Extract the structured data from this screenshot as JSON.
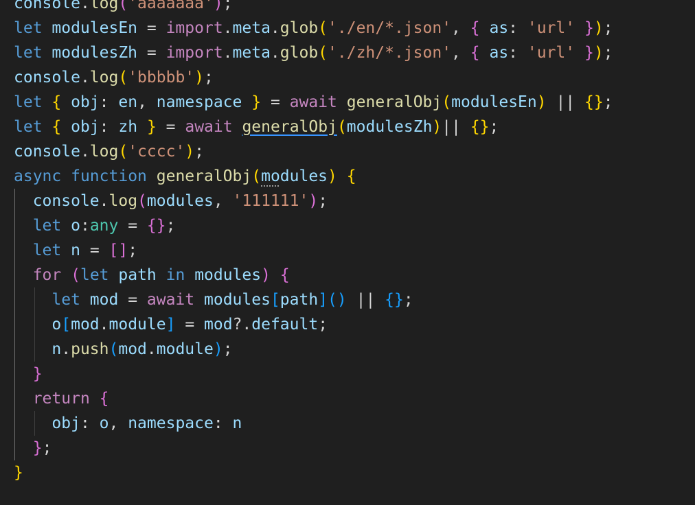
{
  "editor": {
    "theme_colors": {
      "background": "#1f1f1f",
      "keyword_blue": "#569cd6",
      "keyword_control": "#c586c0",
      "variable": "#9cdcfe",
      "function": "#dcdcaa",
      "string": "#ce9178",
      "number": "#b5cea8",
      "type": "#4ec9b0",
      "punctuation": "#d4d4d4",
      "bracket1": "#ffd700",
      "bracket2": "#da70d6",
      "bracket3": "#179fff"
    },
    "lines": [
      {
        "indent": 0,
        "tokens": [
          {
            "t": "console",
            "c": "variable"
          },
          {
            "t": ".",
            "c": "punctuation"
          },
          {
            "t": "log",
            "c": "function"
          },
          {
            "t": "(",
            "c": "bracket2"
          },
          {
            "t": "'aaaaaaa'",
            "c": "string"
          },
          {
            "t": ")",
            "c": "bracket2"
          },
          {
            "t": ";",
            "c": "punctuation"
          }
        ]
      },
      {
        "indent": 0,
        "tokens": [
          {
            "t": "let",
            "c": "keyword_blue"
          },
          {
            "t": " ",
            "c": "punctuation"
          },
          {
            "t": "modulesEn",
            "c": "variable"
          },
          {
            "t": " = ",
            "c": "punctuation"
          },
          {
            "t": "import",
            "c": "keyword_control"
          },
          {
            "t": ".",
            "c": "punctuation"
          },
          {
            "t": "meta",
            "c": "variable"
          },
          {
            "t": ".",
            "c": "punctuation"
          },
          {
            "t": "glob",
            "c": "function"
          },
          {
            "t": "(",
            "c": "bracket1"
          },
          {
            "t": "'./en/*.json'",
            "c": "string"
          },
          {
            "t": ", ",
            "c": "punctuation"
          },
          {
            "t": "{",
            "c": "bracket2"
          },
          {
            "t": " ",
            "c": "punctuation"
          },
          {
            "t": "as",
            "c": "variable"
          },
          {
            "t": ": ",
            "c": "punctuation"
          },
          {
            "t": "'url'",
            "c": "string"
          },
          {
            "t": " ",
            "c": "punctuation"
          },
          {
            "t": "}",
            "c": "bracket2"
          },
          {
            "t": ")",
            "c": "bracket1"
          },
          {
            "t": ";",
            "c": "punctuation"
          }
        ]
      },
      {
        "indent": 0,
        "tokens": [
          {
            "t": "let",
            "c": "keyword_blue"
          },
          {
            "t": " ",
            "c": "punctuation"
          },
          {
            "t": "modulesZh",
            "c": "variable"
          },
          {
            "t": " = ",
            "c": "punctuation"
          },
          {
            "t": "import",
            "c": "keyword_control"
          },
          {
            "t": ".",
            "c": "punctuation"
          },
          {
            "t": "meta",
            "c": "variable"
          },
          {
            "t": ".",
            "c": "punctuation"
          },
          {
            "t": "glob",
            "c": "function"
          },
          {
            "t": "(",
            "c": "bracket1"
          },
          {
            "t": "'./zh/*.json'",
            "c": "string"
          },
          {
            "t": ", ",
            "c": "punctuation"
          },
          {
            "t": "{",
            "c": "bracket2"
          },
          {
            "t": " ",
            "c": "punctuation"
          },
          {
            "t": "as",
            "c": "variable"
          },
          {
            "t": ": ",
            "c": "punctuation"
          },
          {
            "t": "'url'",
            "c": "string"
          },
          {
            "t": " ",
            "c": "punctuation"
          },
          {
            "t": "}",
            "c": "bracket2"
          },
          {
            "t": ")",
            "c": "bracket1"
          },
          {
            "t": ";",
            "c": "punctuation"
          }
        ]
      },
      {
        "indent": 0,
        "tokens": [
          {
            "t": "console",
            "c": "variable"
          },
          {
            "t": ".",
            "c": "punctuation"
          },
          {
            "t": "log",
            "c": "function"
          },
          {
            "t": "(",
            "c": "bracket1"
          },
          {
            "t": "'bbbbb'",
            "c": "string"
          },
          {
            "t": ")",
            "c": "bracket1"
          },
          {
            "t": ";",
            "c": "punctuation"
          }
        ]
      },
      {
        "indent": 0,
        "tokens": [
          {
            "t": "let",
            "c": "keyword_blue"
          },
          {
            "t": " ",
            "c": "punctuation"
          },
          {
            "t": "{",
            "c": "bracket1"
          },
          {
            "t": " ",
            "c": "punctuation"
          },
          {
            "t": "obj",
            "c": "variable"
          },
          {
            "t": ": ",
            "c": "punctuation"
          },
          {
            "t": "en",
            "c": "variable"
          },
          {
            "t": ", ",
            "c": "punctuation"
          },
          {
            "t": "namespace",
            "c": "variable"
          },
          {
            "t": " ",
            "c": "punctuation"
          },
          {
            "t": "}",
            "c": "bracket1"
          },
          {
            "t": " = ",
            "c": "punctuation"
          },
          {
            "t": "await",
            "c": "keyword_control"
          },
          {
            "t": " ",
            "c": "punctuation"
          },
          {
            "t": "generalObj",
            "c": "function"
          },
          {
            "t": "(",
            "c": "bracket1"
          },
          {
            "t": "modulesEn",
            "c": "variable"
          },
          {
            "t": ")",
            "c": "bracket1"
          },
          {
            "t": " || ",
            "c": "punctuation"
          },
          {
            "t": "{}",
            "c": "bracket1"
          },
          {
            "t": ";",
            "c": "punctuation"
          }
        ]
      },
      {
        "indent": 0,
        "tokens": [
          {
            "t": "let",
            "c": "keyword_blue"
          },
          {
            "t": " ",
            "c": "punctuation"
          },
          {
            "t": "{",
            "c": "bracket1"
          },
          {
            "t": " ",
            "c": "punctuation"
          },
          {
            "t": "obj",
            "c": "variable"
          },
          {
            "t": ": ",
            "c": "punctuation"
          },
          {
            "t": "zh",
            "c": "variable"
          },
          {
            "t": " ",
            "c": "punctuation"
          },
          {
            "t": "}",
            "c": "bracket1"
          },
          {
            "t": " = ",
            "c": "punctuation"
          },
          {
            "t": "await",
            "c": "keyword_control"
          },
          {
            "t": " ",
            "c": "punctuation"
          },
          {
            "t": "generalObj",
            "c": "function",
            "u": true
          },
          {
            "t": "(",
            "c": "bracket1"
          },
          {
            "t": "modulesZh",
            "c": "variable"
          },
          {
            "t": ")",
            "c": "bracket1"
          },
          {
            "t": "|| ",
            "c": "punctuation"
          },
          {
            "t": "{}",
            "c": "bracket1"
          },
          {
            "t": ";",
            "c": "punctuation"
          }
        ]
      },
      {
        "indent": 0,
        "tokens": [
          {
            "t": "console",
            "c": "variable"
          },
          {
            "t": ".",
            "c": "punctuation"
          },
          {
            "t": "log",
            "c": "function"
          },
          {
            "t": "(",
            "c": "bracket1"
          },
          {
            "t": "'cccc'",
            "c": "string"
          },
          {
            "t": ")",
            "c": "bracket1"
          },
          {
            "t": ";",
            "c": "punctuation"
          }
        ]
      },
      {
        "indent": 0,
        "tokens": [
          {
            "t": "async",
            "c": "keyword_blue"
          },
          {
            "t": " ",
            "c": "punctuation"
          },
          {
            "t": "function",
            "c": "keyword_blue"
          },
          {
            "t": " ",
            "c": "punctuation"
          },
          {
            "t": "generalObj",
            "c": "function"
          },
          {
            "t": "(",
            "c": "bracket1"
          },
          {
            "t": "mo",
            "c": "variable",
            "d": true
          },
          {
            "t": "dules",
            "c": "variable"
          },
          {
            "t": ")",
            "c": "bracket1"
          },
          {
            "t": " ",
            "c": "punctuation"
          },
          {
            "t": "{",
            "c": "bracket1"
          }
        ]
      },
      {
        "indent": 1,
        "tokens": [
          {
            "t": "console",
            "c": "variable"
          },
          {
            "t": ".",
            "c": "punctuation"
          },
          {
            "t": "log",
            "c": "function"
          },
          {
            "t": "(",
            "c": "bracket2"
          },
          {
            "t": "modules",
            "c": "variable"
          },
          {
            "t": ", ",
            "c": "punctuation"
          },
          {
            "t": "'111111'",
            "c": "string"
          },
          {
            "t": ")",
            "c": "bracket2"
          },
          {
            "t": ";",
            "c": "punctuation"
          }
        ]
      },
      {
        "indent": 1,
        "tokens": [
          {
            "t": "let",
            "c": "keyword_blue"
          },
          {
            "t": " ",
            "c": "punctuation"
          },
          {
            "t": "o",
            "c": "variable"
          },
          {
            "t": ":",
            "c": "punctuation"
          },
          {
            "t": "any",
            "c": "type"
          },
          {
            "t": " = ",
            "c": "punctuation"
          },
          {
            "t": "{}",
            "c": "bracket2"
          },
          {
            "t": ";",
            "c": "punctuation"
          }
        ]
      },
      {
        "indent": 1,
        "tokens": [
          {
            "t": "let",
            "c": "keyword_blue"
          },
          {
            "t": " ",
            "c": "punctuation"
          },
          {
            "t": "n",
            "c": "variable"
          },
          {
            "t": " = ",
            "c": "punctuation"
          },
          {
            "t": "[]",
            "c": "bracket2"
          },
          {
            "t": ";",
            "c": "punctuation"
          }
        ]
      },
      {
        "indent": 1,
        "tokens": [
          {
            "t": "for",
            "c": "keyword_control"
          },
          {
            "t": " ",
            "c": "punctuation"
          },
          {
            "t": "(",
            "c": "bracket2"
          },
          {
            "t": "let",
            "c": "keyword_blue"
          },
          {
            "t": " ",
            "c": "punctuation"
          },
          {
            "t": "path",
            "c": "variable"
          },
          {
            "t": " ",
            "c": "punctuation"
          },
          {
            "t": "in",
            "c": "keyword_blue"
          },
          {
            "t": " ",
            "c": "punctuation"
          },
          {
            "t": "modules",
            "c": "variable"
          },
          {
            "t": ")",
            "c": "bracket2"
          },
          {
            "t": " ",
            "c": "punctuation"
          },
          {
            "t": "{",
            "c": "bracket2"
          }
        ]
      },
      {
        "indent": 2,
        "tokens": [
          {
            "t": "let",
            "c": "keyword_blue"
          },
          {
            "t": " ",
            "c": "punctuation"
          },
          {
            "t": "mod",
            "c": "variable"
          },
          {
            "t": " = ",
            "c": "punctuation"
          },
          {
            "t": "await",
            "c": "keyword_control"
          },
          {
            "t": " ",
            "c": "punctuation"
          },
          {
            "t": "modules",
            "c": "variable"
          },
          {
            "t": "[",
            "c": "bracket3"
          },
          {
            "t": "path",
            "c": "variable"
          },
          {
            "t": "]",
            "c": "bracket3"
          },
          {
            "t": "()",
            "c": "bracket3"
          },
          {
            "t": " || ",
            "c": "punctuation"
          },
          {
            "t": "{}",
            "c": "bracket3"
          },
          {
            "t": ";",
            "c": "punctuation"
          }
        ]
      },
      {
        "indent": 2,
        "tokens": [
          {
            "t": "o",
            "c": "variable"
          },
          {
            "t": "[",
            "c": "bracket3"
          },
          {
            "t": "mod",
            "c": "variable"
          },
          {
            "t": ".",
            "c": "punctuation"
          },
          {
            "t": "module",
            "c": "variable"
          },
          {
            "t": "]",
            "c": "bracket3"
          },
          {
            "t": " = ",
            "c": "punctuation"
          },
          {
            "t": "mod",
            "c": "variable"
          },
          {
            "t": "?.",
            "c": "punctuation"
          },
          {
            "t": "default",
            "c": "variable"
          },
          {
            "t": ";",
            "c": "punctuation"
          }
        ]
      },
      {
        "indent": 2,
        "tokens": [
          {
            "t": "n",
            "c": "variable"
          },
          {
            "t": ".",
            "c": "punctuation"
          },
          {
            "t": "push",
            "c": "function"
          },
          {
            "t": "(",
            "c": "bracket3"
          },
          {
            "t": "mod",
            "c": "variable"
          },
          {
            "t": ".",
            "c": "punctuation"
          },
          {
            "t": "module",
            "c": "variable"
          },
          {
            "t": ")",
            "c": "bracket3"
          },
          {
            "t": ";",
            "c": "punctuation"
          }
        ]
      },
      {
        "indent": 1,
        "tokens": [
          {
            "t": "}",
            "c": "bracket2"
          }
        ]
      },
      {
        "indent": 1,
        "tokens": [
          {
            "t": "return",
            "c": "keyword_control"
          },
          {
            "t": " ",
            "c": "punctuation"
          },
          {
            "t": "{",
            "c": "bracket2"
          }
        ]
      },
      {
        "indent": 2,
        "tokens": [
          {
            "t": "obj",
            "c": "variable"
          },
          {
            "t": ": ",
            "c": "punctuation"
          },
          {
            "t": "o",
            "c": "variable"
          },
          {
            "t": ", ",
            "c": "punctuation"
          },
          {
            "t": "namespace",
            "c": "variable"
          },
          {
            "t": ": ",
            "c": "punctuation"
          },
          {
            "t": "n",
            "c": "variable"
          }
        ]
      },
      {
        "indent": 1,
        "tokens": [
          {
            "t": "}",
            "c": "bracket2"
          },
          {
            "t": ";",
            "c": "punctuation"
          }
        ]
      },
      {
        "indent": 0,
        "tokens": [
          {
            "t": "}",
            "c": "bracket1"
          }
        ]
      }
    ]
  }
}
